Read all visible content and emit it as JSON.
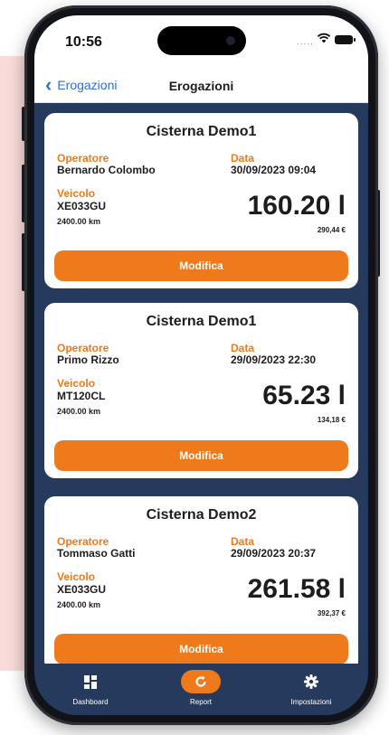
{
  "status": {
    "time": "10:56",
    "signal": "....."
  },
  "nav": {
    "back_label": "Erogazioni",
    "title": "Erogazioni"
  },
  "cards": [
    {
      "title": "Cisterna Demo1",
      "operator_label": "Operatore",
      "operator": "Bernardo Colombo",
      "date_label": "Data",
      "date": "30/09/2023 09:04",
      "vehicle_label": "Veicolo",
      "vehicle": "XE033GU",
      "km": "2400.00 km",
      "liters": "160.20 l",
      "euro": "290,44 €",
      "button": "Modifica"
    },
    {
      "title": "Cisterna Demo1",
      "operator_label": "Operatore",
      "operator": "Primo Rizzo",
      "date_label": "Data",
      "date": "29/09/2023 22:30",
      "vehicle_label": "Veicolo",
      "vehicle": "MT120CL",
      "km": "2400.00 km",
      "liters": "65.23 l",
      "euro": "134,18 €",
      "button": "Modifica"
    },
    {
      "title": "Cisterna Demo2",
      "operator_label": "Operatore",
      "operator": "Tommaso Gatti",
      "date_label": "Data",
      "date": "29/09/2023 20:37",
      "vehicle_label": "Veicolo",
      "vehicle": "XE033GU",
      "km": "2400.00 km",
      "liters": "261.58 l",
      "euro": "392,37 €",
      "button": "Modifica"
    }
  ],
  "tabs": [
    {
      "label": "Dashboard",
      "icon": "grid-icon",
      "active": false
    },
    {
      "label": "Report",
      "icon": "refresh-icon",
      "active": true
    },
    {
      "label": "Impostazioni",
      "icon": "gear-icon",
      "active": false
    }
  ],
  "colors": {
    "accent": "#ee7a1b",
    "navy": "#263a5e",
    "link": "#2f6ee0",
    "backdrop": "#f9dcd9"
  }
}
